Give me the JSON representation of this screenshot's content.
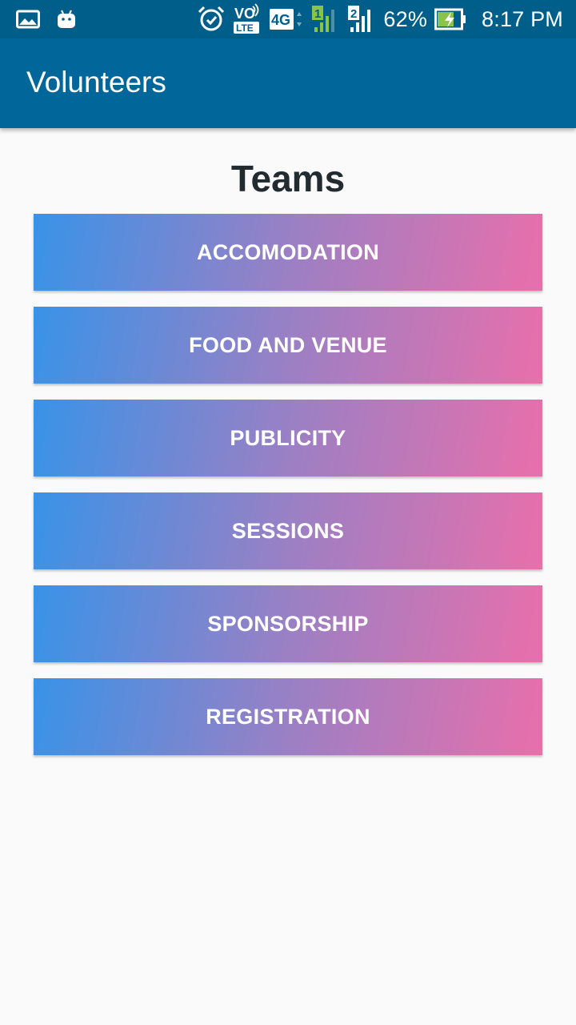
{
  "status_bar": {
    "battery_percent": "62%",
    "time": "8:17 PM",
    "network_type": "4G",
    "volte_top": "VO",
    "volte_bottom": "LTE",
    "sim1": "1",
    "sim2": "2",
    "icons": [
      "gallery-icon",
      "android-icon",
      "alarm-icon",
      "volte-icon",
      "network-4g-icon",
      "signal-sim1-icon",
      "signal-sim2-icon",
      "battery-charging-icon"
    ]
  },
  "app_bar": {
    "title": "Volunteers"
  },
  "main": {
    "section_title": "Teams",
    "teams": [
      {
        "label": "ACCOMODATION"
      },
      {
        "label": "FOOD AND VENUE"
      },
      {
        "label": "PUBLICITY"
      },
      {
        "label": "SESSIONS"
      },
      {
        "label": "SPONSORSHIP"
      },
      {
        "label": "REGISTRATION"
      }
    ]
  },
  "colors": {
    "status_bar": "#005f8a",
    "app_bar": "#016699",
    "gradient_start": "#3893e8",
    "gradient_end": "#e96fab",
    "background": "#fafafa",
    "battery_fill": "#8bc34a"
  }
}
